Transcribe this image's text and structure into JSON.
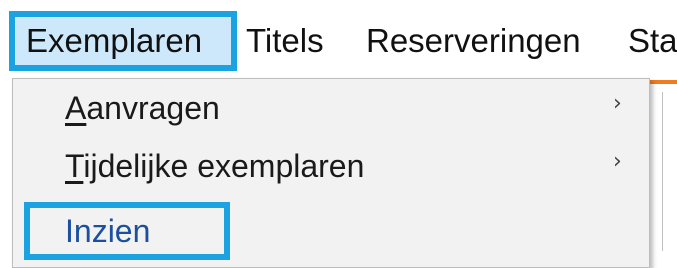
{
  "menubar": {
    "items": [
      {
        "label": "Exemplaren",
        "selected": true
      },
      {
        "label": "Titels"
      },
      {
        "label": "Reserveringen"
      },
      {
        "label": "Sta"
      }
    ]
  },
  "dropdown": {
    "items": [
      {
        "mnemonic": "A",
        "rest": "anvragen",
        "has_submenu": true,
        "chevron": "›"
      },
      {
        "mnemonic": "T",
        "rest": "ijdelijke exemplaren",
        "has_submenu": true,
        "chevron": "›"
      },
      {
        "label": "Inzien",
        "has_submenu": false,
        "highlighted": true
      }
    ]
  },
  "colors": {
    "highlight_outline": "#1aa3e0",
    "selected_bg": "#cde8fa",
    "menu_bg": "#f2f2f2",
    "accent": "#f07b20",
    "link_text": "#1b4fa0"
  }
}
